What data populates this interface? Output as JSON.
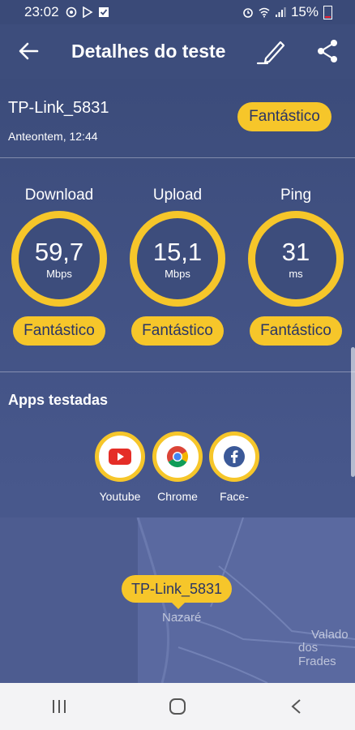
{
  "status_bar": {
    "time": "23:02",
    "battery": "15%"
  },
  "header": {
    "title": "Detalhes do teste",
    "back_icon": "arrow-left-icon",
    "edit_icon": "pencil-icon",
    "share_icon": "share-icon"
  },
  "network": {
    "name": "TP-Link_5831",
    "date": "Anteontem, 12:44",
    "rating": "Fantástico"
  },
  "metrics": [
    {
      "label": "Download",
      "value": "59,7",
      "unit": "Mbps",
      "rating": "Fantástico"
    },
    {
      "label": "Upload",
      "value": "15,1",
      "unit": "Mbps",
      "rating": "Fantástico"
    },
    {
      "label": "Ping",
      "value": "31",
      "unit": "ms",
      "rating": "Fantástico"
    }
  ],
  "apps": {
    "title": "Apps testadas",
    "items": [
      {
        "name": "Youtube",
        "icon": "youtube-icon"
      },
      {
        "name": "Chrome",
        "icon": "chrome-icon"
      },
      {
        "name": "Face-",
        "icon": "facebook-icon"
      }
    ]
  },
  "map": {
    "marker": "TP-Link_5831",
    "town": "Nazaré",
    "place_line1": "Valado",
    "place_line2": "dos Frades"
  },
  "colors": {
    "accent": "#f6c62a",
    "background": "#4a5a8a",
    "header": "#3d4d7c"
  }
}
